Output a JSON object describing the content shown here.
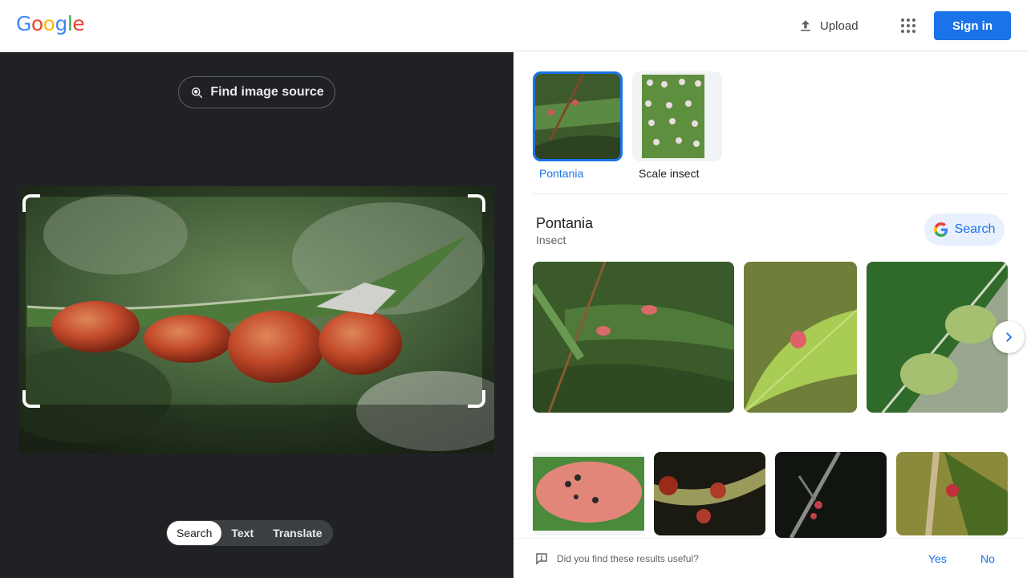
{
  "header": {
    "logo_letters": [
      "G",
      "o",
      "o",
      "g",
      "l",
      "e"
    ],
    "upload_label": "Upload",
    "signin_label": "Sign in"
  },
  "left": {
    "find_source_label": "Find image source",
    "modes": [
      {
        "label": "Search",
        "active": true
      },
      {
        "label": "Text",
        "active": false
      },
      {
        "label": "Translate",
        "active": false
      }
    ]
  },
  "right": {
    "chips": [
      {
        "label": "Pontania",
        "selected": true
      },
      {
        "label": "Scale insect",
        "selected": false
      }
    ],
    "knowledge": {
      "title": "Pontania",
      "subtitle": "Insect",
      "search_label": "Search"
    },
    "feedback": {
      "question": "Did you find these results useful?",
      "yes": "Yes",
      "no": "No"
    }
  },
  "colors": {
    "accent": "#1a73e8",
    "dark_bg": "#202124",
    "google_blue": "#4285f4",
    "google_red": "#ea4335",
    "google_yellow": "#fbbc05",
    "google_green": "#34a853"
  },
  "icons": [
    "upload-icon",
    "apps-grid-icon",
    "lens-search-icon",
    "google-g-icon",
    "chevron-right-icon",
    "feedback-icon"
  ]
}
